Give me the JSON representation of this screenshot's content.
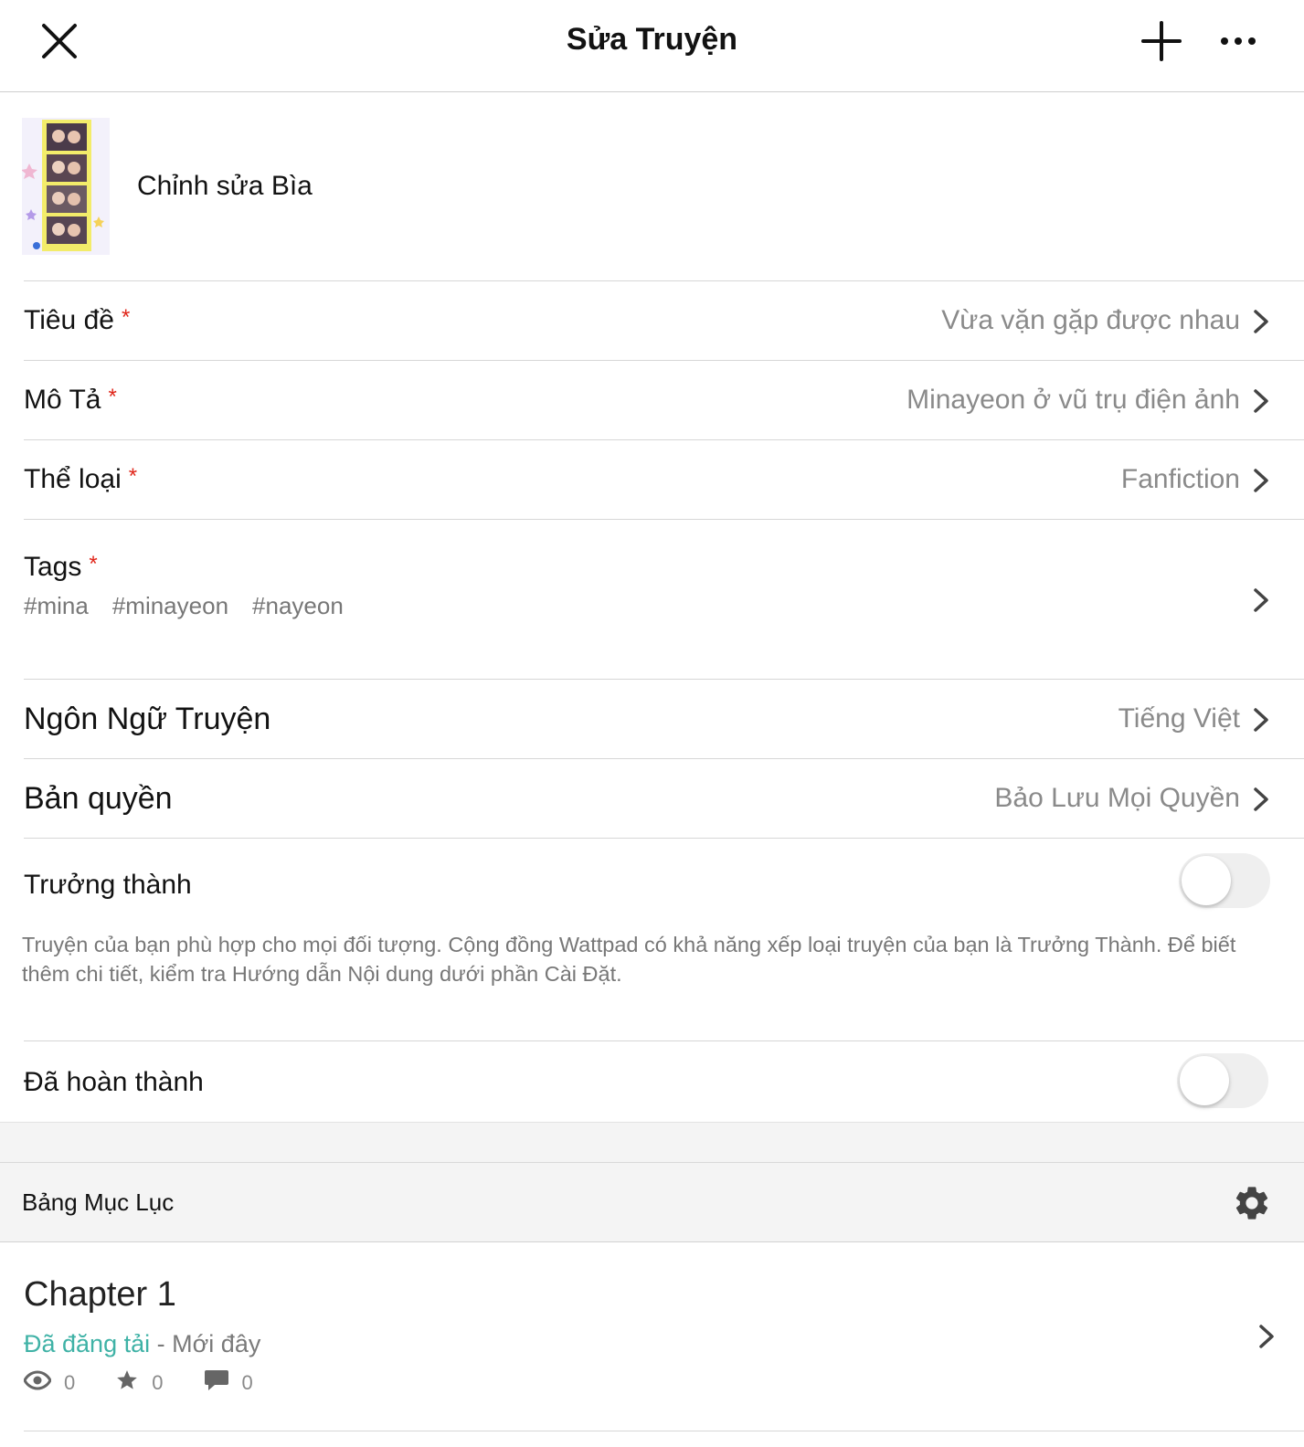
{
  "header": {
    "title": "Sửa Truyện",
    "close_icon": "close-icon",
    "add_icon": "plus-icon",
    "more_icon": "more-horizontal-icon"
  },
  "cover": {
    "label": "Chỉnh sửa Bìa"
  },
  "fields": {
    "title": {
      "label": "Tiêu đề",
      "required": "*",
      "value": "Vừa vặn gặp được nhau"
    },
    "description": {
      "label": "Mô Tả",
      "required": "*",
      "value": "Minayeon ở vũ trụ điện ảnh"
    },
    "genre": {
      "label": "Thể loại",
      "required": "*",
      "value": "Fanfiction"
    },
    "language": {
      "label": "Ngôn Ngữ Truyện",
      "value": "Tiếng Việt"
    },
    "copyright": {
      "label": "Bản quyền",
      "value": "Bảo Lưu Mọi Quyền"
    }
  },
  "tags": {
    "label": "Tags",
    "required": "*",
    "items": [
      "#mina",
      "#minayeon",
      "#nayeon"
    ]
  },
  "mature": {
    "label": "Trưởng thành",
    "enabled": false,
    "note": "Truyện của bạn phù hợp cho mọi đối tượng. Cộng đồng Wattpad có khả năng xếp loại truyện của bạn là Trưởng Thành. Để biết thêm chi tiết, kiểm tra Hướng dẫn Nội dung dưới phần Cài Đặt."
  },
  "completed": {
    "label": "Đã hoàn thành",
    "enabled": false
  },
  "toc": {
    "title": "Bảng Mục Lục",
    "settings_icon": "gear-icon"
  },
  "chapters": [
    {
      "title": "Chapter 1",
      "status": "Đã đăng tải",
      "separator": " - ",
      "time": "Mới đây",
      "views": "0",
      "votes": "0",
      "comments": "0"
    }
  ],
  "colors": {
    "accent_published": "#3fb2a6",
    "required": "#e0261a"
  }
}
